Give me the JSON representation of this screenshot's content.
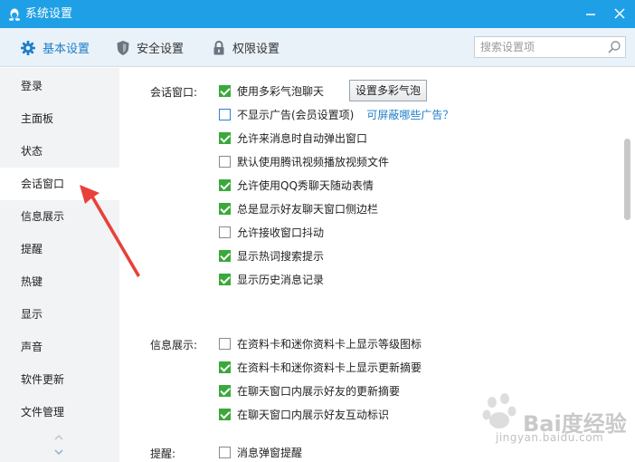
{
  "window": {
    "title": "系统设置"
  },
  "tabs": [
    {
      "label": "基本设置",
      "icon": "gear-icon",
      "active": true
    },
    {
      "label": "安全设置",
      "icon": "shield-icon",
      "active": false
    },
    {
      "label": "权限设置",
      "icon": "lock-icon",
      "active": false
    }
  ],
  "search": {
    "placeholder": "搜索设置项"
  },
  "sidebar": {
    "items": [
      {
        "label": "登录"
      },
      {
        "label": "主面板"
      },
      {
        "label": "状态"
      },
      {
        "label": "会话窗口",
        "active": true
      },
      {
        "label": "信息展示"
      },
      {
        "label": "提醒"
      },
      {
        "label": "热键"
      },
      {
        "label": "显示"
      },
      {
        "label": "声音"
      },
      {
        "label": "软件更新"
      },
      {
        "label": "文件管理"
      }
    ]
  },
  "sections": {
    "chat_window": {
      "label": "会话窗口:",
      "button": "设置多彩气泡",
      "link": "可屏蔽哪些广告？",
      "options": [
        {
          "label": "使用多彩气泡聊天",
          "checked": true
        },
        {
          "label": "不显示广告(会员设置项)",
          "checked": false
        },
        {
          "label": "允许来消息时自动弹出窗口",
          "checked": true
        },
        {
          "label": "默认使用腾讯视频播放视频文件",
          "checked": false
        },
        {
          "label": "允许使用QQ秀聊天随动表情",
          "checked": true
        },
        {
          "label": "总是显示好友聊天窗口侧边栏",
          "checked": true
        },
        {
          "label": "允许接收窗口抖动",
          "checked": false
        },
        {
          "label": "显示热词搜索提示",
          "checked": true
        },
        {
          "label": "显示历史消息记录",
          "checked": true
        }
      ]
    },
    "info_display": {
      "label": "信息展示:",
      "options": [
        {
          "label": "在资料卡和迷你资料卡上显示等级图标",
          "checked": false
        },
        {
          "label": "在资料卡和迷你资料卡上显示更新摘要",
          "checked": true
        },
        {
          "label": "在聊天窗口内展示好友的更新摘要",
          "checked": true
        },
        {
          "label": "在聊天窗口内展示好友互动标识",
          "checked": true
        }
      ]
    },
    "reminder": {
      "label": "提醒:",
      "options": [
        {
          "label": "消息弹窗提醒",
          "checked": false
        }
      ]
    }
  },
  "watermark": {
    "brand": "Bai度经验",
    "url": "jingyan.baidu.com"
  },
  "colors": {
    "titlebar": "#1fa0e6",
    "accent": "#1e7fc9",
    "check": "#3aa93a",
    "arrow": "#e8413a"
  }
}
